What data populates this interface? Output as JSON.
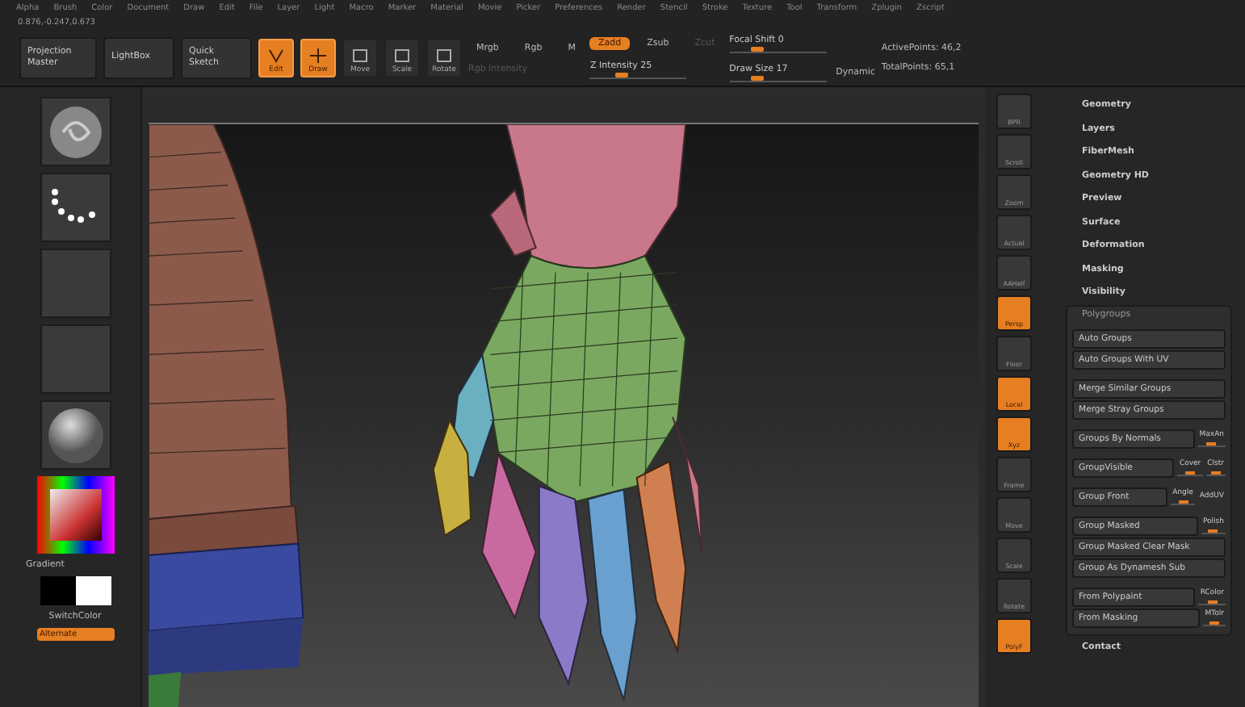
{
  "menu_bar": {
    "items": [
      "Alpha",
      "Brush",
      "Color",
      "Document",
      "Draw",
      "Edit",
      "File",
      "Layer",
      "Light",
      "Macro",
      "Marker",
      "Material",
      "Movie",
      "Picker",
      "Preferences",
      "Render",
      "Stencil",
      "Stroke",
      "Texture",
      "Tool",
      "Transform",
      "Zplugin",
      "Zscript"
    ]
  },
  "coordinates": "0.876,-0.247,0.673",
  "toolbar": {
    "projection_master": "Projection Master",
    "lightbox": "LightBox",
    "quick_sketch": "Quick Sketch",
    "modes": [
      {
        "label": "Edit",
        "selected": true
      },
      {
        "label": "Draw",
        "selected": true
      },
      {
        "label": "Move",
        "selected": false
      },
      {
        "label": "Scale",
        "selected": false
      },
      {
        "label": "Rotate",
        "selected": false
      }
    ],
    "color_modes": [
      {
        "label": "Mrgb",
        "selected": false
      },
      {
        "label": "Rgb",
        "selected": false
      },
      {
        "label": "M",
        "selected": false
      }
    ],
    "rgb_intensity": {
      "label": "Rgb Intensity",
      "disabled": true
    },
    "z_modes": [
      {
        "label": "Zadd",
        "selected": true,
        "disabled": false
      },
      {
        "label": "Zsub",
        "selected": false,
        "disabled": false
      },
      {
        "label": "Zcut",
        "selected": false,
        "disabled": true
      }
    ],
    "sliders": [
      {
        "label": "Focal Shift",
        "value": "0",
        "level": 0.25
      },
      {
        "label": "Z Intensity",
        "value": "25",
        "level": 0.3
      },
      {
        "label": "Draw Size",
        "value": "17",
        "level": 0.25
      }
    ],
    "dynamic": "Dynamic",
    "stats": [
      {
        "label": "ActivePoints:",
        "value": "46,2"
      },
      {
        "label": "TotalPoints:",
        "value": "65,1"
      }
    ]
  },
  "left_panel": {
    "tiles": [
      {
        "kind": "brush"
      },
      {
        "kind": "stroke"
      },
      {
        "kind": "alpha"
      },
      {
        "kind": "texture"
      },
      {
        "kind": "material"
      }
    ],
    "gradient": "Gradient",
    "switch_color": "SwitchColor",
    "alternate": "Alternate"
  },
  "right_shelf": {
    "items": [
      {
        "label": "BPR",
        "selected": false
      },
      {
        "label": "Scroll",
        "selected": false
      },
      {
        "label": "Zoom",
        "selected": false
      },
      {
        "label": "Actual",
        "selected": false
      },
      {
        "label": "AAHalf",
        "selected": false
      },
      {
        "label": "Persp",
        "selected": true
      },
      {
        "label": "Floor",
        "selected": false
      },
      {
        "label": "Local",
        "selected": true
      },
      {
        "label": "Xyz",
        "selected": true
      },
      {
        "label": "Frame",
        "selected": false
      },
      {
        "label": "Move",
        "selected": false
      },
      {
        "label": "Scale",
        "selected": false
      },
      {
        "label": "Rotate",
        "selected": false
      },
      {
        "label": "PolyF",
        "selected": true
      }
    ]
  },
  "tool_palette": {
    "subpalettes": [
      "Geometry",
      "Layers",
      "FiberMesh",
      "Geometry HD",
      "Preview",
      "Surface",
      "Deformation",
      "Masking",
      "Visibility"
    ],
    "polygroups": {
      "title": "Polygroups",
      "groups": [
        [
          {
            "label": "Auto Groups"
          },
          {
            "label": "Auto Groups With UV"
          }
        ],
        [
          {
            "label": "Merge Similar Groups"
          },
          {
            "label": "Merge Stray Groups"
          }
        ],
        [
          {
            "label": "Groups By Normals",
            "extra": [
              {
                "label": "MaxAn",
                "level": 0.5
              }
            ]
          }
        ],
        [
          {
            "label": "GroupVisible",
            "extra": [
              {
                "label": "Cover",
                "level": 0.5
              },
              {
                "label": "Clstr",
                "level": 0.5
              }
            ]
          }
        ],
        [
          {
            "label": "Group Front",
            "extra": [
              {
                "label": "Angle",
                "level": 0.5
              },
              {
                "label": "AddUV"
              }
            ]
          }
        ],
        [
          {
            "label": "Group Masked",
            "extra": [
              {
                "label": "Polish",
                "level": 0.5
              }
            ]
          },
          {
            "label": "Group Masked Clear Mask"
          },
          {
            "label": "Group As Dynamesh Sub"
          }
        ],
        [
          {
            "label": "From Polypaint",
            "extra": [
              {
                "label": "RColor",
                "level": 0.5
              }
            ]
          },
          {
            "label": "From Masking",
            "extra": [
              {
                "label": "MTolr",
                "level": 0.5
              }
            ]
          }
        ]
      ]
    },
    "after": [
      "Contact"
    ]
  }
}
